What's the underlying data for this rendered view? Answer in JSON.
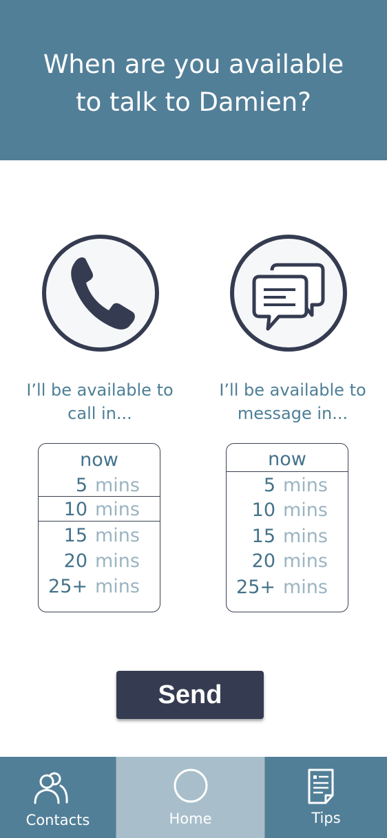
{
  "header": {
    "title_line1": "When are you available",
    "title_line2": "to talk to Damien?"
  },
  "options": {
    "call": {
      "icon": "phone-icon",
      "caption_line1": "I’ll be available to",
      "caption_line2": "call in...",
      "selected": "10 mins",
      "rows": [
        {
          "num": "now",
          "unit": ""
        },
        {
          "num": "5",
          "unit": "mins"
        },
        {
          "num": "10",
          "unit": "mins"
        },
        {
          "num": "15",
          "unit": "mins"
        },
        {
          "num": "20",
          "unit": "mins"
        },
        {
          "num": "25+",
          "unit": "mins"
        }
      ]
    },
    "message": {
      "icon": "chat-bubbles-icon",
      "caption_line1": "I’ll be available to",
      "caption_line2": "message in...",
      "selected": "now",
      "rows": [
        {
          "num": "now",
          "unit": ""
        },
        {
          "num": "5",
          "unit": "mins"
        },
        {
          "num": "10",
          "unit": "mins"
        },
        {
          "num": "15",
          "unit": "mins"
        },
        {
          "num": "20",
          "unit": "mins"
        },
        {
          "num": "25+",
          "unit": "mins"
        }
      ]
    }
  },
  "send_label": "Send",
  "tabbar": {
    "contacts": {
      "label": "Contacts",
      "icon": "contacts-icon"
    },
    "home": {
      "label": "Home",
      "icon": "home-circle-icon"
    },
    "tips": {
      "label": "Tips",
      "icon": "tips-document-icon"
    }
  },
  "colors": {
    "header": "#527f98",
    "accent_text": "#4d7f96",
    "dark": "#353c51",
    "tab_active": "#a8bfcb"
  }
}
